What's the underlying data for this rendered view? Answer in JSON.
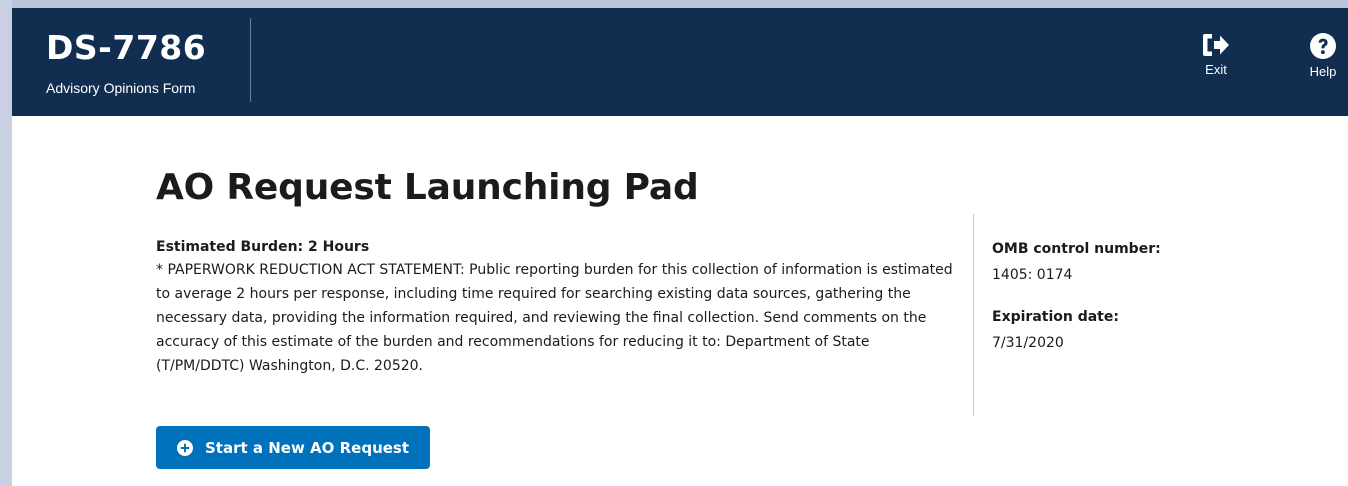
{
  "header": {
    "form_code": "DS-7786",
    "form_name": "Advisory Opinions Form",
    "actions": {
      "exit_label": "Exit",
      "help_label": "Help"
    }
  },
  "main": {
    "title": "AO Request Launching Pad",
    "burden": {
      "heading": "Estimated Burden: 2 Hours",
      "text": "* PAPERWORK REDUCTION ACT STATEMENT: Public reporting burden for this collection of information is estimated to average 2 hours per response, including time required for searching existing data sources, gathering the necessary data, providing the information required, and reviewing the final collection. Send comments on the accuracy of this estimate of the burden and recommendations for reducing it to: Department of State (T/PM/DDTC) Washington, D.C. 20520."
    },
    "omb": {
      "control_label": "OMB control number:",
      "control_value": "1405: 0174",
      "expiration_label": "Expiration date:",
      "expiration_value": "7/31/2020"
    },
    "start_button_label": "Start a New AO Request"
  },
  "icons": {
    "exit": "exit-icon",
    "help": "help-icon",
    "plus": "plus-circle-icon"
  },
  "colors": {
    "header_bg": "#112e51",
    "primary_button": "#0071bb"
  }
}
